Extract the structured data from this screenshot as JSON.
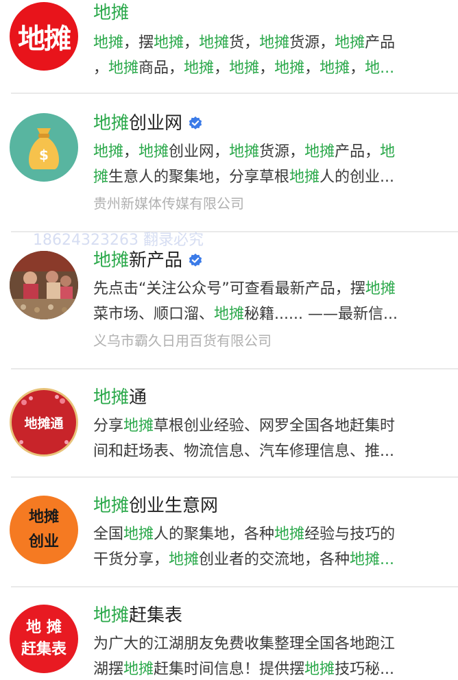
{
  "colors": {
    "highlight": "#2aa84a",
    "verified": "#3b7be8",
    "subtitle": "#b0b0b0",
    "divider": "#e9e9e9"
  },
  "watermark": "18624323263 翻录必究",
  "results": [
    {
      "avatar_icon": "ditan-logo-red-circle",
      "avatar_text": [
        "地摊"
      ],
      "title": [
        {
          "t": "地摊",
          "hl": true
        }
      ],
      "verified": false,
      "desc_lines": [
        [
          {
            "t": "地摊",
            "hl": true
          },
          {
            "t": "，摆",
            "hl": false
          },
          {
            "t": "地摊",
            "hl": true
          },
          {
            "t": "，",
            "hl": false
          },
          {
            "t": "地摊",
            "hl": true
          },
          {
            "t": "货，",
            "hl": false
          },
          {
            "t": "地摊",
            "hl": true
          },
          {
            "t": "货源，",
            "hl": false
          },
          {
            "t": "地摊",
            "hl": true
          },
          {
            "t": "产品",
            "hl": false
          }
        ],
        [
          {
            "t": "，",
            "hl": false
          },
          {
            "t": "地摊",
            "hl": true
          },
          {
            "t": "商品，",
            "hl": false
          },
          {
            "t": "地摊",
            "hl": true
          },
          {
            "t": "，",
            "hl": false
          },
          {
            "t": "地摊",
            "hl": true
          },
          {
            "t": "，",
            "hl": false
          },
          {
            "t": "地摊",
            "hl": true
          },
          {
            "t": "，",
            "hl": false
          },
          {
            "t": "地摊",
            "hl": true
          },
          {
            "t": "，",
            "hl": false
          },
          {
            "t": "地...",
            "hl": true
          }
        ]
      ],
      "subtitle": ""
    },
    {
      "avatar_icon": "money-bag-icon",
      "avatar_text": [
        "$"
      ],
      "title": [
        {
          "t": "地摊",
          "hl": true
        },
        {
          "t": "创业网",
          "hl": false
        }
      ],
      "verified": true,
      "desc_lines": [
        [
          {
            "t": "地摊",
            "hl": true
          },
          {
            "t": "，",
            "hl": false
          },
          {
            "t": "地摊",
            "hl": true
          },
          {
            "t": "创业网，",
            "hl": false
          },
          {
            "t": "地摊",
            "hl": true
          },
          {
            "t": "货源，",
            "hl": false
          },
          {
            "t": "地摊",
            "hl": true
          },
          {
            "t": "产品，",
            "hl": false
          },
          {
            "t": "地",
            "hl": true
          }
        ],
        [
          {
            "t": "摊",
            "hl": true
          },
          {
            "t": "生意人的聚集地，分享草根",
            "hl": false
          },
          {
            "t": "地摊",
            "hl": true
          },
          {
            "t": "人的创业...",
            "hl": false
          }
        ]
      ],
      "subtitle": "贵州新媒体传媒有限公司"
    },
    {
      "avatar_icon": "market-photo",
      "avatar_text": [],
      "title": [
        {
          "t": "地摊",
          "hl": true
        },
        {
          "t": "新产品",
          "hl": false
        }
      ],
      "verified": true,
      "desc_lines": [
        [
          {
            "t": "先点击“关注公众号”可查看最新产品，摆",
            "hl": false
          },
          {
            "t": "地摊",
            "hl": true
          }
        ],
        [
          {
            "t": "菜市场、顺口溜、",
            "hl": false
          },
          {
            "t": "地摊",
            "hl": true
          },
          {
            "t": "秘籍...... ——最新信...",
            "hl": false
          }
        ]
      ],
      "subtitle": "义乌市霸久日用百货有限公司"
    },
    {
      "avatar_icon": "ditantong-logo",
      "avatar_text": [
        "地摊通"
      ],
      "title": [
        {
          "t": "地摊",
          "hl": true
        },
        {
          "t": "通",
          "hl": false
        }
      ],
      "verified": false,
      "desc_lines": [
        [
          {
            "t": "分享",
            "hl": false
          },
          {
            "t": "地摊",
            "hl": true
          },
          {
            "t": "草根创业经验、网罗全国各地赶集时",
            "hl": false
          }
        ],
        [
          {
            "t": "间和赶场表、物流信息、汽车修理信息、推...",
            "hl": false
          }
        ]
      ],
      "subtitle": ""
    },
    {
      "avatar_icon": "ditan-chuangye-logo",
      "avatar_text": [
        "地摊",
        "创业"
      ],
      "title": [
        {
          "t": "地摊",
          "hl": true
        },
        {
          "t": "创业生意网",
          "hl": false
        }
      ],
      "verified": false,
      "desc_lines": [
        [
          {
            "t": "全国",
            "hl": false
          },
          {
            "t": "地摊",
            "hl": true
          },
          {
            "t": "人的聚集地，各种",
            "hl": false
          },
          {
            "t": "地摊",
            "hl": true
          },
          {
            "t": "经验与技巧的",
            "hl": false
          }
        ],
        [
          {
            "t": "干货分享，",
            "hl": false
          },
          {
            "t": "地摊",
            "hl": true
          },
          {
            "t": "创业者的交流地，各种",
            "hl": false
          },
          {
            "t": "地摊...",
            "hl": true
          }
        ]
      ],
      "subtitle": ""
    },
    {
      "avatar_icon": "ganjibiao-logo",
      "avatar_text": [
        "地 摊",
        "赶集表"
      ],
      "title": [
        {
          "t": "地摊",
          "hl": true
        },
        {
          "t": "赶集表",
          "hl": false
        }
      ],
      "verified": false,
      "desc_lines": [
        [
          {
            "t": "为广大的江湖朋友免费收集整理全国各地跑江",
            "hl": false
          }
        ],
        [
          {
            "t": "湖摆",
            "hl": false
          },
          {
            "t": "地摊",
            "hl": true
          },
          {
            "t": "赶集时间信息！提供摆",
            "hl": false
          },
          {
            "t": "地摊",
            "hl": true
          },
          {
            "t": "技巧秘...",
            "hl": false
          }
        ]
      ],
      "subtitle": ""
    }
  ]
}
